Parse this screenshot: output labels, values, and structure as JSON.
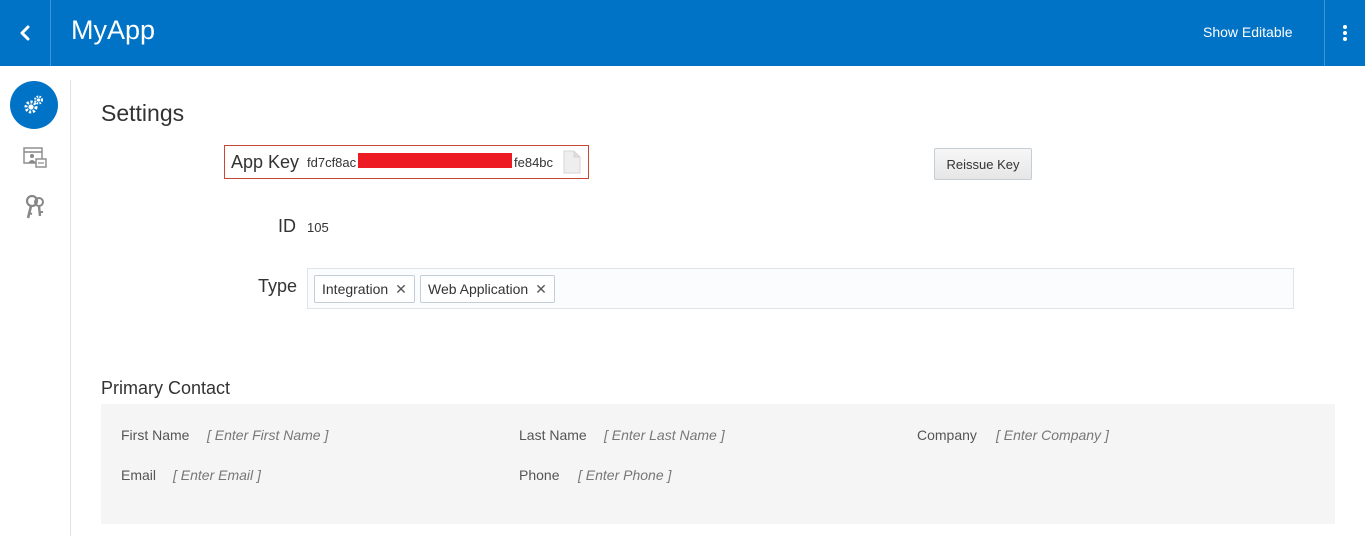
{
  "colors": {
    "accent": "#0073c6",
    "redaction": "#ed1c24"
  },
  "header": {
    "back_icon": "chevron-left-icon",
    "title": "MyApp",
    "show_editable_label": "Show Editable",
    "more_icon": "vertical-dots-icon"
  },
  "sidebar": {
    "items": [
      {
        "icon": "gears-icon",
        "active": true
      },
      {
        "icon": "app-users-icon",
        "active": false
      },
      {
        "icon": "keys-icon",
        "active": false
      }
    ]
  },
  "settings": {
    "title": "Settings",
    "app_key": {
      "label": "App Key",
      "value_start": "fd7cf8ac",
      "value_end": "fe84bc",
      "copy_icon": "copy-icon"
    },
    "reissue_label": "Reissue Key",
    "id_label": "ID",
    "id_value": "105",
    "type_label": "Type",
    "types": [
      "Integration",
      "Web Application"
    ],
    "remove_glyph": "✕"
  },
  "contact": {
    "title": "Primary Contact",
    "first_name": {
      "label": "First Name",
      "placeholder": "[ Enter First Name ]"
    },
    "last_name": {
      "label": "Last Name",
      "placeholder": "[ Enter Last Name ]"
    },
    "company": {
      "label": "Company",
      "placeholder": "[ Enter Company ]"
    },
    "email": {
      "label": "Email",
      "placeholder": "[ Enter Email ]"
    },
    "phone": {
      "label": "Phone",
      "placeholder": "[ Enter Phone ]"
    }
  }
}
